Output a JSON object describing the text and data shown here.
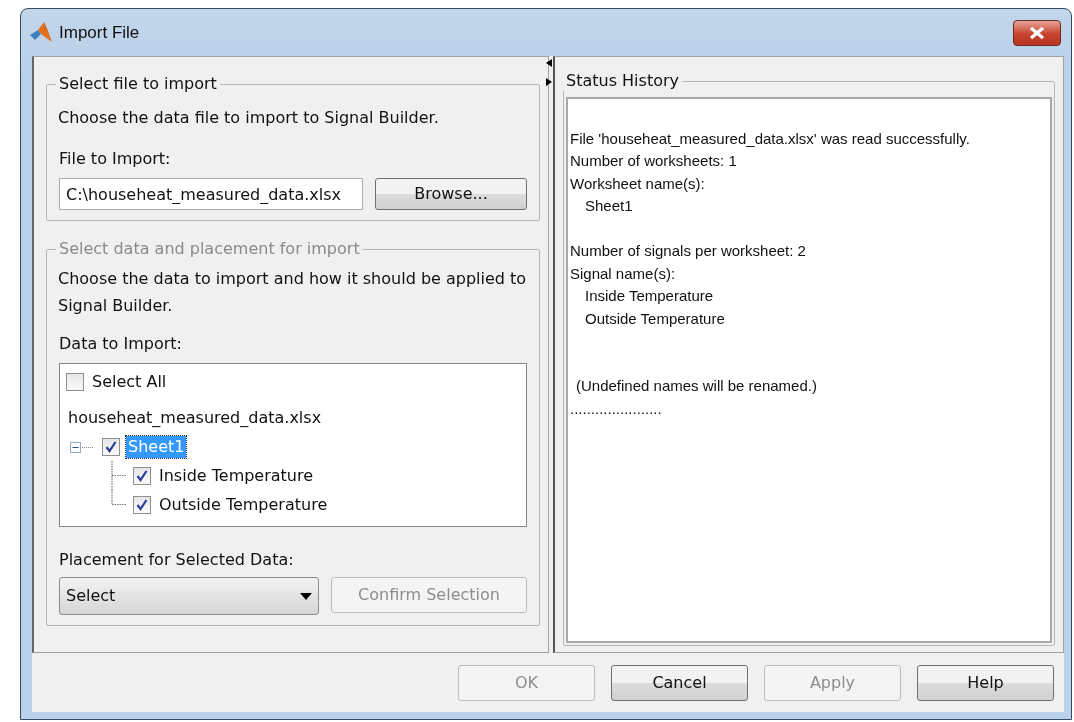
{
  "window": {
    "title": "Import File"
  },
  "file_section": {
    "title": "Select file to import",
    "description": "Choose the data file to import to Signal Builder.",
    "field_label": "File to Import:",
    "file_path": "C:\\househeat_measured_data.xlsx",
    "browse_button": "Browse..."
  },
  "data_section": {
    "title": "Select data and placement for import",
    "disabled": true,
    "description": "Choose the data to import and how it should be applied to Signal Builder.",
    "tree_label": "Data to Import:",
    "select_all": {
      "label": "Select All",
      "checked": false
    },
    "file_name": "househeat_measured_data.xlsx",
    "tree": [
      {
        "label": "Sheet1",
        "checked": true,
        "selected": true,
        "expanded": true,
        "children": [
          {
            "label": "Inside Temperature",
            "checked": true,
            "selected": false
          },
          {
            "label": "Outside Temperature",
            "checked": true,
            "selected": false
          }
        ]
      }
    ],
    "placement_label": "Placement for Selected Data:",
    "placement_select": "Select",
    "confirm_button": {
      "label": "Confirm Selection",
      "disabled": true
    }
  },
  "status_history": {
    "title": "Status History",
    "lines": [
      {
        "kind": "blank"
      },
      {
        "kind": "text",
        "text": "File 'househeat_measured_data.xlsx' was read successfully."
      },
      {
        "kind": "text",
        "text": "Number of worksheets: 1"
      },
      {
        "kind": "text",
        "text": "Worksheet name(s):"
      },
      {
        "kind": "item",
        "text": "Sheet1"
      },
      {
        "kind": "blank"
      },
      {
        "kind": "text",
        "text": "Number of signals per worksheet: 2"
      },
      {
        "kind": "text",
        "text": "Signal name(s):"
      },
      {
        "kind": "item",
        "text": "Inside Temperature"
      },
      {
        "kind": "item",
        "text": "Outside Temperature"
      },
      {
        "kind": "blank"
      },
      {
        "kind": "blank"
      },
      {
        "kind": "note",
        "text": "(Undefined names will be renamed.)"
      },
      {
        "kind": "text",
        "text": "......................"
      }
    ]
  },
  "buttons": [
    {
      "label": "OK",
      "disabled": true
    },
    {
      "label": "Cancel",
      "disabled": false
    },
    {
      "label": "Apply",
      "disabled": true
    },
    {
      "label": "Help",
      "disabled": false
    }
  ]
}
